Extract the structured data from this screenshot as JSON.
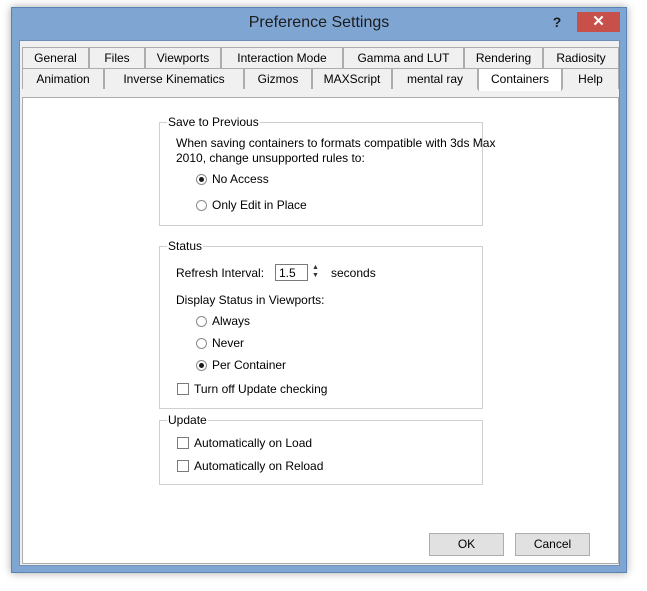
{
  "window": {
    "title": "Preference Settings",
    "help_glyph": "?",
    "close_glyph": "✕"
  },
  "tabs": {
    "row1": [
      "General",
      "Files",
      "Viewports",
      "Interaction Mode",
      "Gamma and LUT",
      "Rendering",
      "Radiosity"
    ],
    "row2": [
      "Animation",
      "Inverse Kinematics",
      "Gizmos",
      "MAXScript",
      "mental ray",
      "Containers",
      "Help"
    ],
    "active": "Containers"
  },
  "save_to_previous": {
    "label": "Save to Previous",
    "desc_line1": "When saving containers to formats compatible with 3ds Max",
    "desc_line2": "2010, change unsupported rules to:",
    "opt_no_access": "No Access",
    "opt_only_edit": "Only Edit in Place",
    "selected": "No Access"
  },
  "status": {
    "label": "Status",
    "refresh_label": "Refresh Interval:",
    "refresh_value": "1.5",
    "refresh_unit": "seconds",
    "display_label": "Display Status in Viewports:",
    "opt_always": "Always",
    "opt_never": "Never",
    "opt_per_container": "Per Container",
    "selected": "Per Container",
    "turn_off_update": "Turn off Update checking",
    "turn_off_update_checked": false
  },
  "update": {
    "label": "Update",
    "auto_on_load": "Automatically on Load",
    "auto_on_load_checked": false,
    "auto_on_reload": "Automatically on Reload",
    "auto_on_reload_checked": false
  },
  "buttons": {
    "ok": "OK",
    "cancel": "Cancel"
  },
  "colors": {
    "frame": "#7fa6d3",
    "close": "#c7504a",
    "panel": "#ffffff"
  }
}
